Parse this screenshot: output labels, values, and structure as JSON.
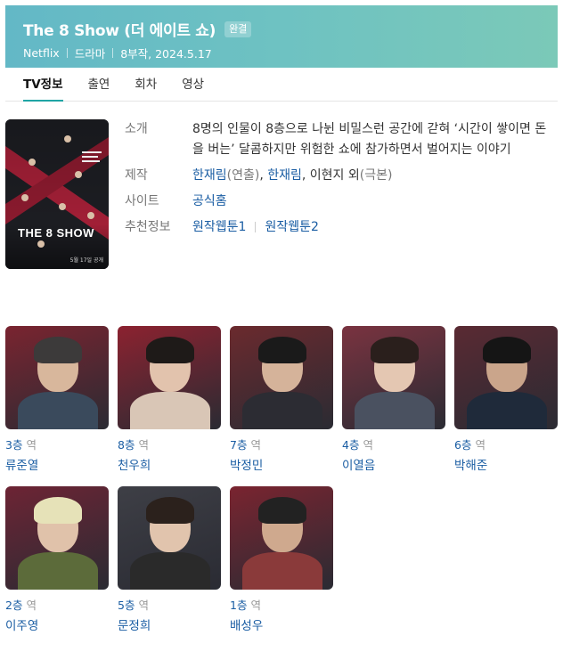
{
  "header": {
    "title": "The 8 Show (더 에이트 쇼)",
    "badge": "완결",
    "meta": [
      "Netflix",
      "드라마",
      "8부작, 2024.5.17"
    ],
    "bg_color": "#6ec2c2"
  },
  "tabs": [
    {
      "label": "TV정보",
      "active": true
    },
    {
      "label": "출연",
      "active": false
    },
    {
      "label": "회차",
      "active": false
    },
    {
      "label": "영상",
      "active": false
    }
  ],
  "poster": {
    "brand": "THE 8 SHOW",
    "date": "5월 17일 공개"
  },
  "info": {
    "intro_label": "소개",
    "intro_text": "8명의 인물이 8층으로 나뉜 비밀스런 공간에 갇혀 ‘시간이 쌓이면 돈을 버는’ 달콤하지만 위험한 쇼에 참가하면서 벌어지는 이야기",
    "production_label": "제작",
    "production": {
      "director": "한재림",
      "director_role": "(연출)",
      "writers": [
        "한재림",
        "이현지 외"
      ],
      "writer_role": "(극본)"
    },
    "site_label": "사이트",
    "site_link": "공식홈",
    "recommend_label": "추천정보",
    "recommend_links": [
      "원작웹툰1",
      "원작웹툰2"
    ]
  },
  "cast": [
    {
      "role": "3층",
      "suffix": "역",
      "actor": "류준열",
      "bg": "#7a2430",
      "skin": "#d8b79c",
      "cloth": "#3a4a5c",
      "hair": "#3c3a3a"
    },
    {
      "role": "8층",
      "suffix": "역",
      "actor": "천우희",
      "bg": "#8c2230",
      "skin": "#e2c3ad",
      "cloth": "#d9c6b6",
      "hair": "#1e1a18"
    },
    {
      "role": "7층",
      "suffix": "역",
      "actor": "박정민",
      "bg": "#6b2a2e",
      "skin": "#d5b39a",
      "cloth": "#2c2c33",
      "hair": "#1a1a1a"
    },
    {
      "role": "4층",
      "suffix": "역",
      "actor": "이열음",
      "bg": "#7a3340",
      "skin": "#e4c7b2",
      "cloth": "#4a5160",
      "hair": "#2a1f1c"
    },
    {
      "role": "6층",
      "suffix": "역",
      "actor": "박해준",
      "bg": "#5a2a33",
      "skin": "#caa58b",
      "cloth": "#1f2a3a",
      "hair": "#151515"
    },
    {
      "role": "2층",
      "suffix": "역",
      "actor": "이주영",
      "bg": "#6d2434",
      "skin": "#e0c2aa",
      "cloth": "#5c6b3a",
      "hair": "#e6e2b8"
    },
    {
      "role": "5층",
      "suffix": "역",
      "actor": "문정희",
      "bg": "#3e3f46",
      "skin": "#e1c4ad",
      "cloth": "#2a2a2a",
      "hair": "#2b211c"
    },
    {
      "role": "1층",
      "suffix": "역",
      "actor": "배성우",
      "bg": "#7a2430",
      "skin": "#cfa98e",
      "cloth": "#8a3a3a",
      "hair": "#222"
    }
  ]
}
